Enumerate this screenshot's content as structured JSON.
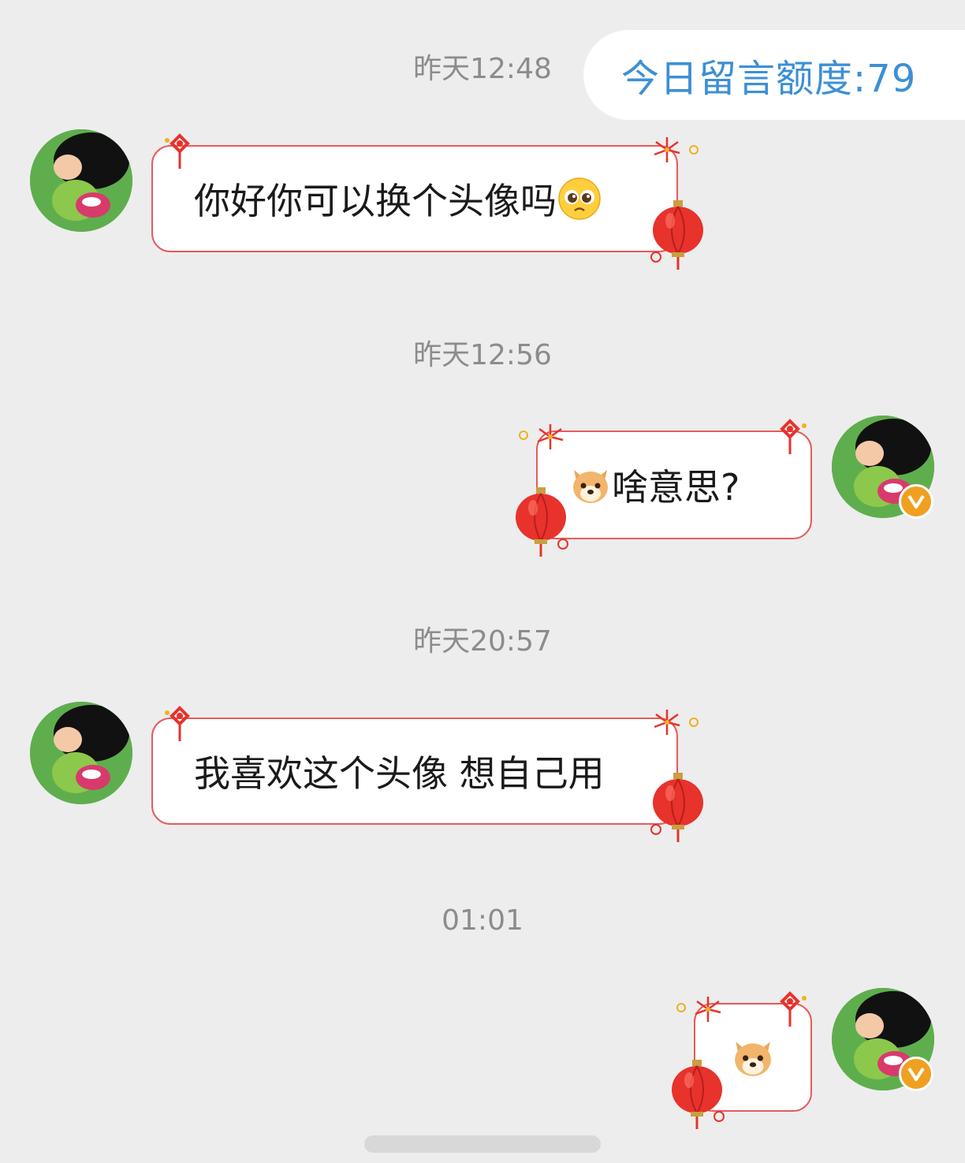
{
  "quota": {
    "text": "今日留言额度:79"
  },
  "messages": [
    {
      "time": "昨天12:48",
      "side": "left",
      "text": "你好你可以换个头像吗",
      "emoji": "pleading-face"
    },
    {
      "time": "昨天12:56",
      "side": "right",
      "text": "啥意思?",
      "emoji": "shiba-dog-face"
    },
    {
      "time": "昨天20:57",
      "side": "left",
      "text": "我喜欢这个头像 想自己用"
    },
    {
      "time": "01:01",
      "side": "right",
      "text": "",
      "emoji": "shiba-dog-face"
    }
  ],
  "colors": {
    "accent": "#3d8fd6",
    "bubble_border": "#e85a5a",
    "lantern": "#e8322c",
    "verified_badge": "#f0a020",
    "background": "#ededed",
    "timestamp": "#8c8c8c"
  },
  "icons": [
    "avatar-image",
    "verified-badge-icon",
    "lantern-icon",
    "chinese-knot-icon",
    "firework-icon",
    "pleading-face-emoji",
    "shiba-dog-emoji"
  ]
}
